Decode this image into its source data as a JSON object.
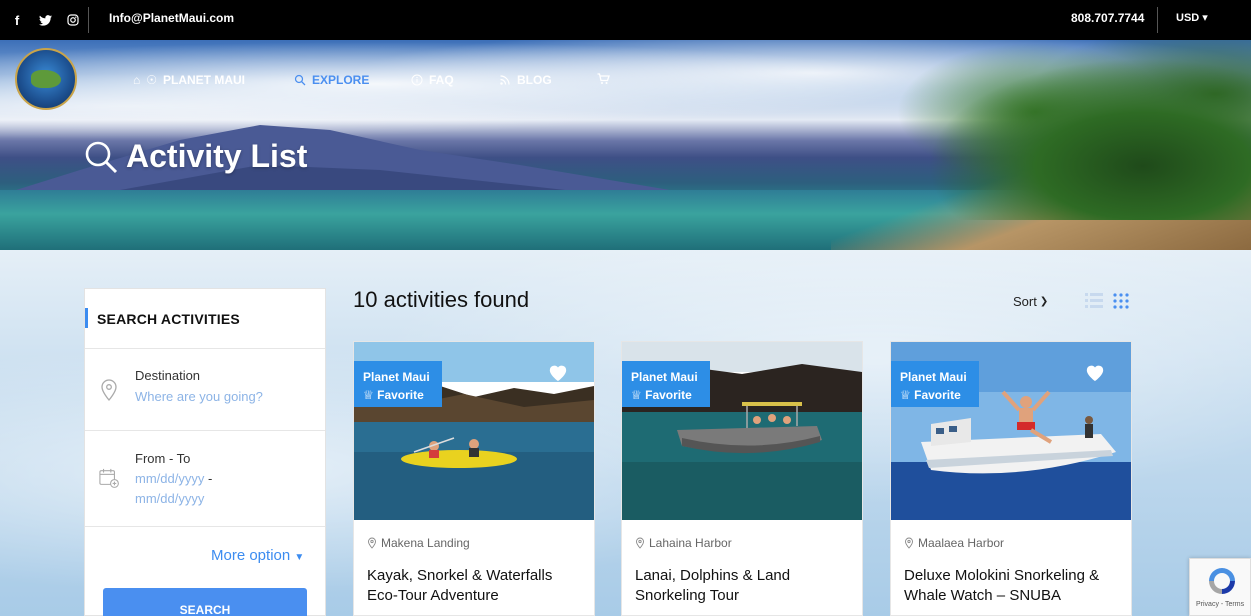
{
  "topbar": {
    "social_icons": [
      "facebook-icon",
      "twitter-icon",
      "instagram-icon"
    ],
    "email": "Info@PlanetMaui.com",
    "phone": "808.707.7744",
    "currency": "USD"
  },
  "nav": {
    "home": "PLANET MAUI",
    "explore": "EXPLORE",
    "faq": "FAQ",
    "blog": "BLOG",
    "cart_icon": "cart-icon"
  },
  "hero": {
    "title": "Activity List"
  },
  "sidebar": {
    "heading": "SEARCH ACTIVITIES",
    "destination_label": "Destination",
    "destination_placeholder": "Where are you going?",
    "date_label": "From - To",
    "date_from": "mm/dd/yyyy",
    "date_sep": "-",
    "date_to": "mm/dd/yyyy",
    "more_option": "More option",
    "search_button": "SEARCH"
  },
  "results": {
    "count_text": "10 activities found",
    "sort_label": "Sort"
  },
  "cards": [
    {
      "badge_line1": "Planet Maui",
      "badge_line2": "Favorite",
      "location": "Makena Landing",
      "title": "Kayak, Snorkel & Waterfalls Eco-Tour Adventure"
    },
    {
      "badge_line1": "Planet Maui",
      "badge_line2": "Favorite",
      "location": "Lahaina Harbor",
      "title": "Lanai, Dolphins & Land Snorkeling Tour"
    },
    {
      "badge_line1": "Planet Maui",
      "badge_line2": "Favorite",
      "location": "Maalaea Harbor",
      "title": "Deluxe Molokini Snorkeling & Whale Watch – SNUBA"
    }
  ],
  "recaptcha": {
    "text": "Privacy - Terms"
  },
  "colors": {
    "accent": "#3c8cf0",
    "badge": "#2d8ee6",
    "topbar": "#000000"
  }
}
